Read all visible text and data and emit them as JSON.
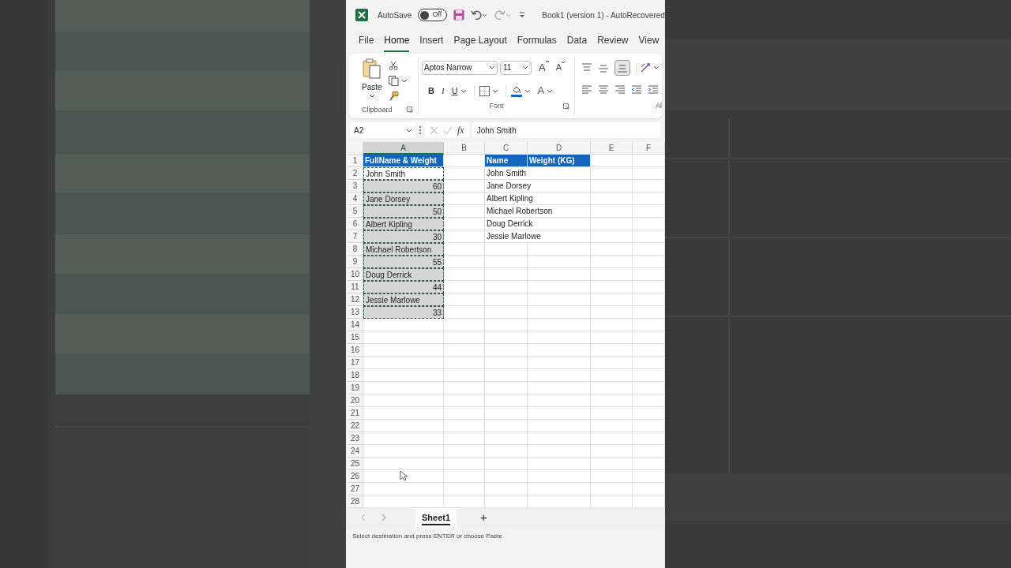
{
  "title_bar": {
    "autosave_label": "AutoSave",
    "autosave_toggle": {
      "label": "Off",
      "on": false
    },
    "document_title": "Book1 (version 1) - AutoRecovered"
  },
  "tabs": [
    {
      "label": "File",
      "selected": false
    },
    {
      "label": "Home",
      "selected": true
    },
    {
      "label": "Insert",
      "selected": false
    },
    {
      "label": "Page Layout",
      "selected": false
    },
    {
      "label": "Formulas",
      "selected": false
    },
    {
      "label": "Data",
      "selected": false
    },
    {
      "label": "Review",
      "selected": false
    },
    {
      "label": "View",
      "selected": false
    }
  ],
  "ribbon": {
    "clipboard": {
      "paste_label": "Paste",
      "group_label": "Clipboard"
    },
    "font": {
      "font_name": "Aptos Narrow",
      "font_size": "11",
      "grow": "A",
      "shrink": "A",
      "bold": "B",
      "italic": "I",
      "underline": "U",
      "font_color": "A",
      "group_label": "Font"
    },
    "alignment": {
      "group_label": "Al"
    }
  },
  "formula_bar": {
    "name_box": "A2",
    "fx": "fx",
    "value": "John Smith"
  },
  "grid": {
    "columns": [
      {
        "label": "A",
        "selected": true
      },
      {
        "label": "B",
        "selected": false
      },
      {
        "label": "C",
        "selected": false
      },
      {
        "label": "D",
        "selected": false
      },
      {
        "label": "E",
        "selected": false
      },
      {
        "label": "F",
        "selected": false
      }
    ],
    "rows": [
      {
        "header": "1",
        "kind": "header",
        "selected": false,
        "active": false,
        "cells": {
          "A": {
            "text": "FullName & Weight",
            "right_aligned": false
          },
          "C": {
            "text": "Name",
            "right_aligned": false
          },
          "D": {
            "text": "Weight (KG)",
            "right_aligned": false
          }
        }
      },
      {
        "header": "2",
        "kind": "data",
        "selected": true,
        "active": true,
        "cells": {
          "A": {
            "text": "John Smith",
            "right_aligned": false
          },
          "C": {
            "text": "John Smith",
            "right_aligned": false
          }
        }
      },
      {
        "header": "3",
        "kind": "data",
        "selected": true,
        "active": false,
        "cells": {
          "A": {
            "text": "60",
            "right_aligned": true
          },
          "C": {
            "text": "Jane Dorsey",
            "right_aligned": false
          }
        }
      },
      {
        "header": "4",
        "kind": "data",
        "selected": true,
        "active": false,
        "cells": {
          "A": {
            "text": "Jane Dorsey",
            "right_aligned": false
          },
          "C": {
            "text": "Albert Kipling",
            "right_aligned": false
          }
        }
      },
      {
        "header": "5",
        "kind": "data",
        "selected": true,
        "active": false,
        "cells": {
          "A": {
            "text": "50",
            "right_aligned": true
          },
          "C": {
            "text": "Michael Robertson",
            "right_aligned": false
          }
        }
      },
      {
        "header": "6",
        "kind": "data",
        "selected": true,
        "active": false,
        "cells": {
          "A": {
            "text": "Albert Kipling",
            "right_aligned": false
          },
          "C": {
            "text": "Doug Derrick",
            "right_aligned": false
          }
        }
      },
      {
        "header": "7",
        "kind": "data",
        "selected": true,
        "active": false,
        "cells": {
          "A": {
            "text": "30",
            "right_aligned": true
          },
          "C": {
            "text": "Jessie Marlowe",
            "right_aligned": false
          }
        }
      },
      {
        "header": "8",
        "kind": "data",
        "selected": true,
        "active": false,
        "cells": {
          "A": {
            "text": "Michael Robertson",
            "right_aligned": false
          }
        }
      },
      {
        "header": "9",
        "kind": "data",
        "selected": true,
        "active": false,
        "cells": {
          "A": {
            "text": "55",
            "right_aligned": true
          }
        }
      },
      {
        "header": "10",
        "kind": "data",
        "selected": true,
        "active": false,
        "cells": {
          "A": {
            "text": "Doug Derrick",
            "right_aligned": false
          }
        }
      },
      {
        "header": "11",
        "kind": "data",
        "selected": true,
        "active": false,
        "cells": {
          "A": {
            "text": "44",
            "right_aligned": true
          }
        }
      },
      {
        "header": "12",
        "kind": "data",
        "selected": true,
        "active": false,
        "cells": {
          "A": {
            "text": "Jessie Marlowe",
            "right_aligned": false
          }
        }
      },
      {
        "header": "13",
        "kind": "data",
        "selected": true,
        "active": false,
        "cells": {
          "A": {
            "text": "33",
            "right_aligned": true
          }
        }
      },
      {
        "header": "14",
        "kind": "data",
        "selected": false,
        "active": false,
        "cells": {}
      },
      {
        "header": "15",
        "kind": "data",
        "selected": false,
        "active": false,
        "cells": {}
      },
      {
        "header": "16",
        "kind": "data",
        "selected": false,
        "active": false,
        "cells": {}
      },
      {
        "header": "17",
        "kind": "data",
        "selected": false,
        "active": false,
        "cells": {}
      },
      {
        "header": "18",
        "kind": "data",
        "selected": false,
        "active": false,
        "cells": {}
      },
      {
        "header": "19",
        "kind": "data",
        "selected": false,
        "active": false,
        "cells": {}
      },
      {
        "header": "20",
        "kind": "data",
        "selected": false,
        "active": false,
        "cells": {}
      },
      {
        "header": "21",
        "kind": "data",
        "selected": false,
        "active": false,
        "cells": {}
      },
      {
        "header": "22",
        "kind": "data",
        "selected": false,
        "active": false,
        "cells": {}
      },
      {
        "header": "23",
        "kind": "data",
        "selected": false,
        "active": false,
        "cells": {}
      },
      {
        "header": "24",
        "kind": "data",
        "selected": false,
        "active": false,
        "cells": {}
      },
      {
        "header": "25",
        "kind": "data",
        "selected": false,
        "active": false,
        "cells": {}
      },
      {
        "header": "26",
        "kind": "data",
        "selected": false,
        "active": false,
        "cells": {}
      },
      {
        "header": "27",
        "kind": "data",
        "selected": false,
        "active": false,
        "cells": {}
      },
      {
        "header": "28",
        "kind": "data",
        "selected": false,
        "active": false,
        "cells": {}
      }
    ]
  },
  "sheet_tabs": {
    "tabs": [
      {
        "label": "Sheet1",
        "selected": true
      }
    ],
    "add": "+"
  },
  "status_bar": "Select destination and press ENTER or choose Paste"
}
